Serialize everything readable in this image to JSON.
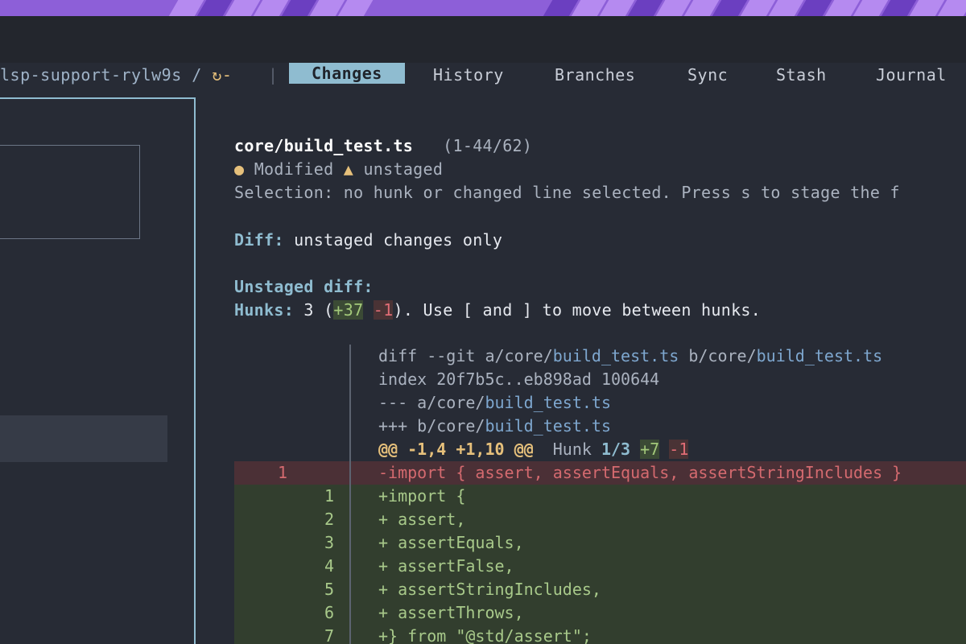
{
  "header": {
    "branch": "lsp-support-rylw9s",
    "branch_sep": "/",
    "sync_glyph": "↻-",
    "separator": "|",
    "tabs": [
      {
        "label": "Changes",
        "active": true
      },
      {
        "label": "History",
        "active": false
      },
      {
        "label": "Branches",
        "active": false
      },
      {
        "label": "Sync",
        "active": false
      },
      {
        "label": "Stash",
        "active": false
      },
      {
        "label": "Journal",
        "active": false
      }
    ]
  },
  "file": {
    "path": "core/build_test.ts",
    "range": "(1-44/62)",
    "status_dot": "●",
    "status": "Modified",
    "warn_glyph": "▲",
    "stage_state": "unstaged",
    "selection_text": "Selection: no hunk or changed line selected. Press s to stage the f"
  },
  "diff_mode": {
    "label": "Diff:",
    "value": "unstaged changes only"
  },
  "unstaged": {
    "heading": "Unstaged diff:",
    "hunks_label": "Hunks:",
    "hunks_count": "3 (",
    "added": "+37",
    "removed": "-1",
    "hint": "). Use [ and ] to move between hunks."
  },
  "diff": {
    "git_prefix": "diff --git a/core/",
    "git_file": "build_test.ts",
    "git_mid": " b/core/",
    "index_line": "index 20f7b5c..eb898ad 100644",
    "old_prefix": "--- a/core/",
    "new_prefix": "+++ b/core/",
    "hunk_header": "@@ -1,4 +1,10 @@",
    "hunk_word": "Hunk",
    "hunk_pos": "1/3",
    "hunk_add": "+7",
    "hunk_del": "-1",
    "deleted_line": {
      "old": "1",
      "code": "-import { assert, assertEquals, assertStringIncludes }"
    },
    "added_lines": [
      {
        "new": "1",
        "code": "+import {"
      },
      {
        "new": "2",
        "code": "+  assert,"
      },
      {
        "new": "3",
        "code": "+  assertEquals,"
      },
      {
        "new": "4",
        "code": "+  assertFalse,"
      },
      {
        "new": "5",
        "code": "+  assertStringIncludes,"
      },
      {
        "new": "6",
        "code": "+  assertThrows,"
      },
      {
        "new": "7",
        "code": "+} from \"@std/assert\";"
      }
    ]
  },
  "colors": {
    "accent": "#8fbcd0",
    "added_bg": "#323e2e",
    "deleted_bg": "#4b3036",
    "background": "#272b35"
  }
}
